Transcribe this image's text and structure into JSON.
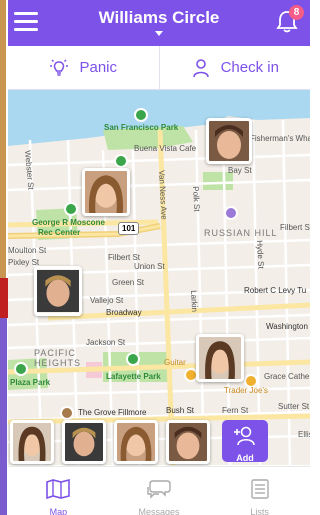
{
  "header": {
    "title": "Williams Circle",
    "notification_count": "8"
  },
  "actions": {
    "panic": "Panic",
    "checkin": "Check in"
  },
  "map_labels": {
    "sf_park": "San Francisco Park",
    "buena_vista": "Buena Vista Cafe",
    "fishermans_wharf": "Fisherman's Whar",
    "bay_st": "Bay St",
    "webster_st": "Webster St",
    "moscone1": "George R Moscone",
    "moscone2": "Rec Center",
    "van_ness": "Van Ness Ave",
    "polk_st": "Polk St",
    "russian_hill": "RUSSIAN HILL",
    "hwy_101": "101",
    "filbert_st": "Filbert St",
    "filbert_st2": "Filbert St",
    "union_st": "Union St",
    "moulton_st": "Moulton St",
    "pixley_st": "Pixley St",
    "green_st": "Green St",
    "vallejo_st": "Vallejo St",
    "broadway": "Broadway",
    "robert_levy": "Robert C Levy Tu",
    "jackson_st": "Jackson St",
    "washington": "Washington",
    "pacific_heights1": "PACIFIC",
    "pacific_heights2": "HEIGHTS",
    "lafayette": "Lafayette Park",
    "plaza_park": "Plaza Park",
    "guitar": "Guitar",
    "trader_joes": "Trader Joe's",
    "grace_cathedral": "Grace Cathe",
    "grove_fillmore": "The Grove Fillmore",
    "bush_st": "Bush St",
    "fern_st": "Fern St",
    "sutter_st": "Sutter St",
    "larkin": "Larkin",
    "hyde": "Hyde St",
    "ellis": "Ellis"
  },
  "add_button": {
    "label": "Add"
  },
  "tabs": [
    {
      "label": "Map",
      "icon": "map-icon",
      "active": true
    },
    {
      "label": "Messages",
      "icon": "chat-bubbles-icon",
      "active": false
    },
    {
      "label": "Lists",
      "icon": "list-document-icon",
      "active": false
    }
  ],
  "colors": {
    "accent": "#7d52e8",
    "park": "#bfe3a6",
    "water": "#a9d8f0",
    "badge": "#f55c8a"
  }
}
